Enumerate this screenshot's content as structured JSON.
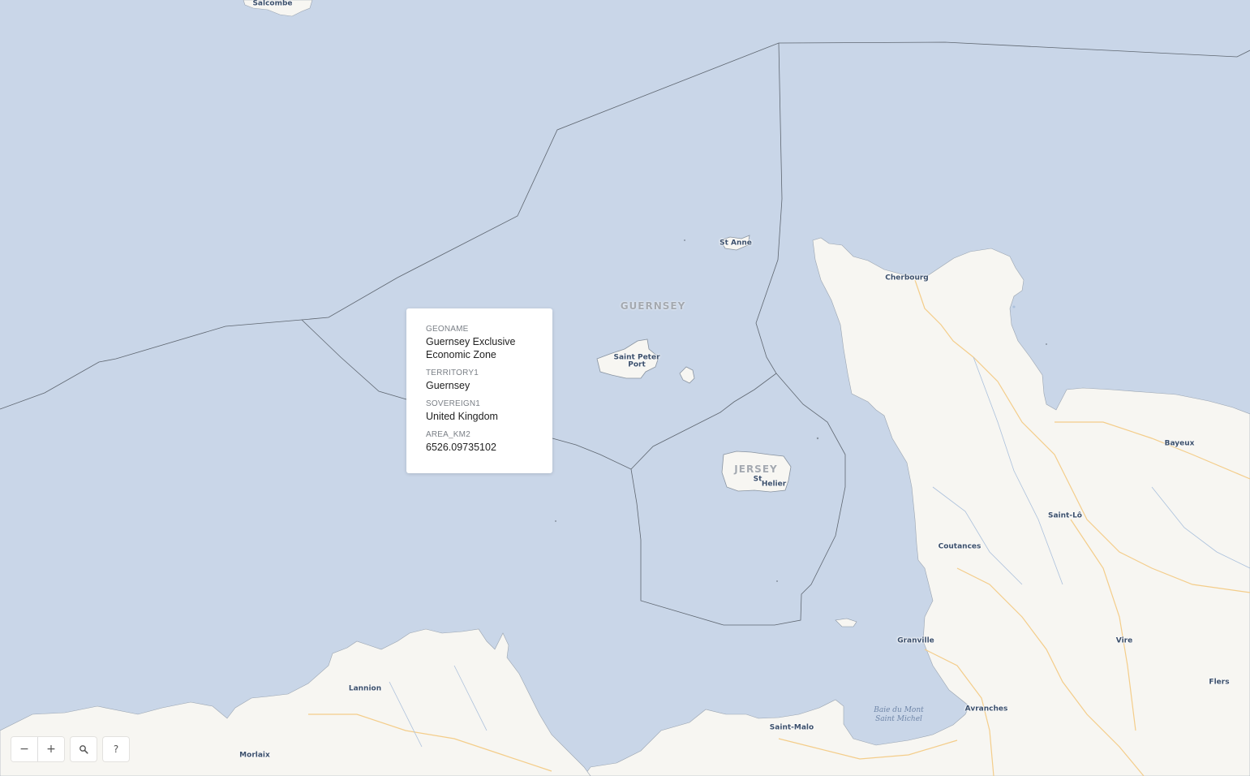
{
  "map": {
    "colors": {
      "sea": "#c9d6e8",
      "land": "#f7f6f2",
      "boundary": "#5e6670",
      "road": "#f4cd8a"
    },
    "places": [
      {
        "id": "salcombe",
        "label": "Salcombe"
      },
      {
        "id": "st-anne",
        "label": "St Anne"
      },
      {
        "id": "cherbourg",
        "label": "Cherbourg"
      },
      {
        "id": "saint-peter-port-1",
        "label": "Saint Peter"
      },
      {
        "id": "saint-peter-port-2",
        "label": "Port"
      },
      {
        "id": "st-helier-1",
        "label": "St"
      },
      {
        "id": "st-helier-2",
        "label": "Helier"
      },
      {
        "id": "bayeux",
        "label": "Bayeux"
      },
      {
        "id": "saint-lo",
        "label": "Saint-Lô"
      },
      {
        "id": "coutances",
        "label": "Coutances"
      },
      {
        "id": "granville",
        "label": "Granville"
      },
      {
        "id": "vire",
        "label": "Vire"
      },
      {
        "id": "flers",
        "label": "Flers"
      },
      {
        "id": "avranches",
        "label": "Avranches"
      },
      {
        "id": "saint-malo",
        "label": "Saint-Malo"
      },
      {
        "id": "lannion",
        "label": "Lannion"
      },
      {
        "id": "morlaix",
        "label": "Morlaix"
      }
    ],
    "regions": [
      {
        "id": "guernsey",
        "label": "GUERNSEY"
      },
      {
        "id": "jersey",
        "label": "JERSEY"
      }
    ],
    "water_labels": [
      {
        "id": "baie-du-mont",
        "line1": "Baie du Mont",
        "line2": "Saint Michel"
      }
    ]
  },
  "popup": {
    "fields": [
      {
        "key": "GEONAME",
        "value": "Guernsey Exclusive Economic Zone"
      },
      {
        "key": "TERRITORY1",
        "value": "Guernsey"
      },
      {
        "key": "SOVEREIGN1",
        "value": "United Kingdom"
      },
      {
        "key": "AREA_KM2",
        "value": "6526.09735102"
      }
    ]
  },
  "controls": {
    "zoom_out": "−",
    "zoom_in": "+",
    "search_icon": "search-icon",
    "help": "?"
  }
}
